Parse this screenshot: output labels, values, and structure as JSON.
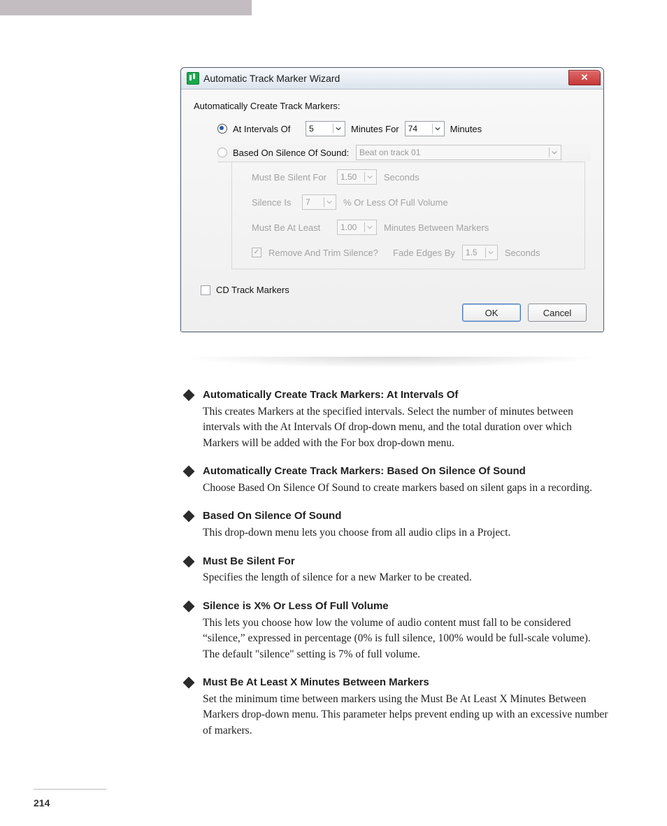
{
  "dialog": {
    "title": "Automatic Track Marker Wizard",
    "section_title": "Automatically Create Track Markers:",
    "at_intervals": {
      "label": "At Intervals Of",
      "value": "5",
      "minutes_for_label": "Minutes For",
      "minutes_for_value": "74",
      "minutes_label": "Minutes"
    },
    "based_on_silence": {
      "label": "Based On Silence Of Sound:",
      "clip_value": "Beat on track 01"
    },
    "must_be_silent": {
      "label": "Must Be Silent For",
      "value": "1.50",
      "seconds": "Seconds"
    },
    "silence_is": {
      "label": "Silence Is",
      "value": "7",
      "suffix": "% Or Less Of Full Volume"
    },
    "must_be_at_least": {
      "label": "Must Be At Least",
      "value": "1.00",
      "suffix": "Minutes Between Markers"
    },
    "remove_trim": {
      "label": "Remove And Trim Silence?",
      "fade_label": "Fade Edges By",
      "fade_value": "1.5",
      "seconds": "Seconds"
    },
    "cd_track_markers_label": "CD Track Markers",
    "ok": "OK",
    "cancel": "Cancel"
  },
  "entries": [
    {
      "title": "Automatically Create Track Markers: At Intervals Of",
      "body": "This creates Markers at the specified intervals. Select the number of minutes between intervals with the At Intervals Of drop-down menu, and the total duration over which Markers will be added with the For box drop-down menu."
    },
    {
      "title": "Automatically Create Track Markers: Based On Silence Of Sound",
      "body": "Choose Based On Silence Of Sound to create markers based on silent gaps in a recording."
    },
    {
      "title": "Based On Silence Of Sound",
      "body": "This drop-down menu lets you choose from all audio clips in a Project."
    },
    {
      "title": "Must Be Silent For",
      "body": "Specifies the length of silence for a new Marker to be created."
    },
    {
      "title": "Silence is X% Or Less Of Full Volume",
      "body": "This lets you choose how low the volume of audio content must fall to be considered “silence,” expressed in percentage (0% is full silence, 100% would be full-scale volume). The default \"silence\" setting is 7% of full volume."
    },
    {
      "title": "Must Be At Least X Minutes Between Markers",
      "body": "Set the minimum time between markers using the Must Be At Least X Minutes Between Markers drop-down menu. This parameter helps prevent ending up with an excessive number of markers."
    }
  ],
  "page_number": "214"
}
